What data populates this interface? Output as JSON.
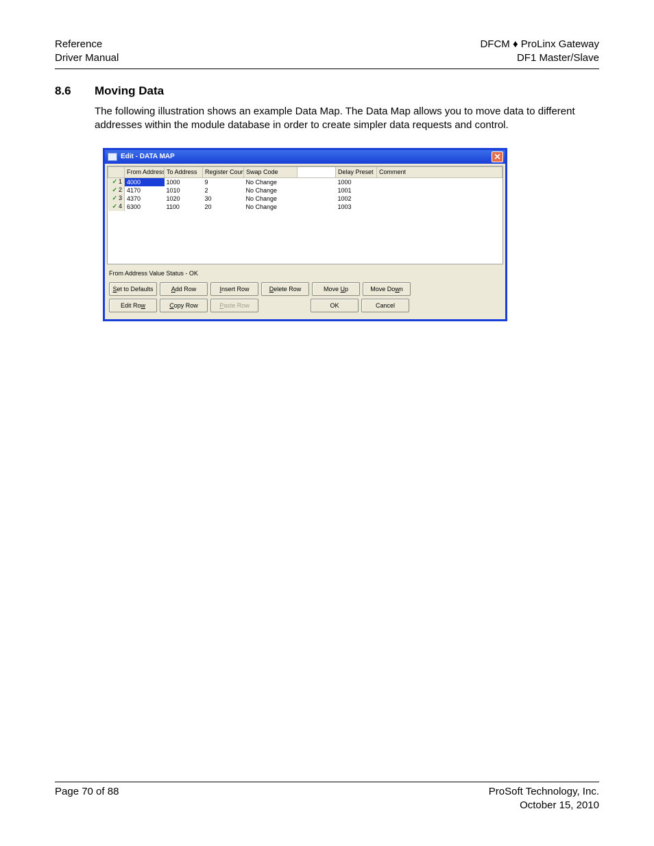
{
  "header": {
    "left1": "Reference",
    "left2": "Driver Manual",
    "right1": "DFCM ♦ ProLinx Gateway",
    "right2": "DF1 Master/Slave"
  },
  "section": {
    "num": "8.6",
    "title": "Moving Data",
    "body": "The following illustration shows an example Data Map. The Data Map allows you to move data to different addresses within the module database in order to create simpler data requests and control."
  },
  "dialog": {
    "title": "Edit - DATA MAP",
    "columns": [
      "",
      "From Address",
      "To Address",
      "Register Count",
      "Swap Code",
      "Delay Preset",
      "Comment"
    ],
    "rows": [
      {
        "idx": "1",
        "from": "4000",
        "to": "1000",
        "reg": "9",
        "swap": "No Change",
        "delay": "1000",
        "comment": "",
        "selected": true
      },
      {
        "idx": "2",
        "from": "4170",
        "to": "1010",
        "reg": "2",
        "swap": "No Change",
        "delay": "1001",
        "comment": ""
      },
      {
        "idx": "3",
        "from": "4370",
        "to": "1020",
        "reg": "30",
        "swap": "No Change",
        "delay": "1002",
        "comment": ""
      },
      {
        "idx": "4",
        "from": "6300",
        "to": "1100",
        "reg": "20",
        "swap": "No Change",
        "delay": "1003",
        "comment": ""
      }
    ],
    "status": "From Address Value Status - OK",
    "buttons": {
      "set_defaults_pre": "S",
      "set_defaults": "et to Defaults",
      "add_row_pre": "A",
      "add_row": "dd Row",
      "insert_row_pre": "I",
      "insert_row": "nsert Row",
      "delete_row_pre": "D",
      "delete_row": "elete Row",
      "move_up_pre": "Move ",
      "move_up_m": "U",
      "move_up_post": "p",
      "move_down_pre": "Move Do",
      "move_down_m": "w",
      "move_down_post": "n",
      "edit_row_pre": "Edit Ro",
      "edit_row_m": "w",
      "edit_row_post": "",
      "copy_row_pre": "C",
      "copy_row": "opy Row",
      "paste_row_pre": "P",
      "paste_row": "aste Row",
      "ok": "OK",
      "cancel": "Cancel"
    }
  },
  "footer": {
    "left": "Page 70 of 88",
    "right1": "ProSoft Technology, Inc.",
    "right2": "October 15, 2010"
  }
}
